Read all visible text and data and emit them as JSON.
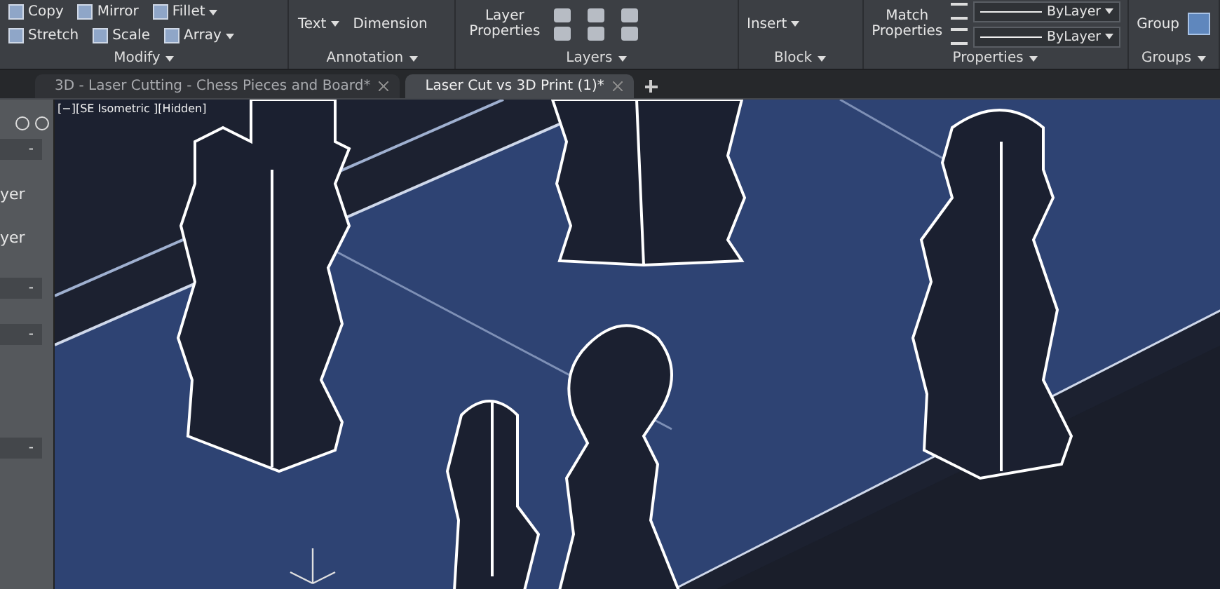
{
  "ribbon": {
    "panels": [
      {
        "title": "Modify",
        "rows": [
          [
            {
              "label": "Copy",
              "dropdown": false
            },
            {
              "label": "Mirror",
              "dropdown": false
            },
            {
              "label": "Fillet",
              "dropdown": true
            }
          ],
          [
            {
              "label": "Stretch",
              "dropdown": false
            },
            {
              "label": "Scale",
              "dropdown": false
            },
            {
              "label": "Array",
              "dropdown": true
            }
          ]
        ]
      },
      {
        "title": "Annotation",
        "rows": [
          [
            {
              "label": "Text",
              "dropdown": true
            },
            {
              "label": "Dimension",
              "dropdown": false
            }
          ]
        ]
      },
      {
        "title": "Layers",
        "rows": [
          [
            {
              "label": "Layer Properties",
              "dropdown": false
            }
          ]
        ]
      },
      {
        "title": "Block",
        "rows": [
          [
            {
              "label": "Insert",
              "dropdown": true
            }
          ]
        ]
      },
      {
        "title": "Properties",
        "rows": [
          [
            {
              "label": "Match Properties"
            }
          ]
        ],
        "selects": [
          {
            "value": "ByLayer"
          },
          {
            "value": "ByLayer"
          }
        ]
      },
      {
        "title": "Groups",
        "rows": [
          [
            {
              "label": "Group",
              "dropdown": false
            }
          ]
        ]
      }
    ]
  },
  "tabs": [
    {
      "label": "3D - Laser Cutting - Chess Pieces and Board*",
      "selected": false
    },
    {
      "label": "Laser Cut vs 3D Print (1)*",
      "selected": true
    }
  ],
  "palette": {
    "texts": [
      "yer",
      "yer"
    ],
    "collapse_buttons": [
      "-",
      "-",
      "-",
      "-"
    ]
  },
  "viewport": {
    "label": "[−][SE Isometric ][Hidden]"
  }
}
